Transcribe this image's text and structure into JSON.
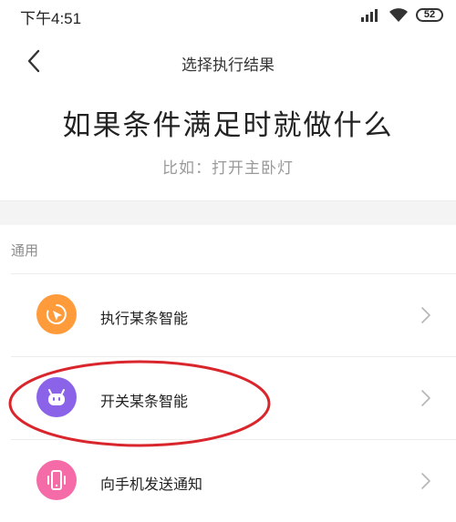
{
  "status_bar": {
    "time": "下午4:51",
    "battery": "52"
  },
  "nav": {
    "title": "选择执行结果"
  },
  "hero": {
    "title": "如果条件满足时就做什么",
    "subtitle": "比如：打开主卧灯"
  },
  "section": {
    "label": "通用"
  },
  "items": [
    {
      "label": "执行某条智能",
      "icon": "hand-pointer-icon",
      "color": "#FF9B3A"
    },
    {
      "label": "开关某条智能",
      "icon": "robot-icon",
      "color": "#8A63E8"
    },
    {
      "label": "向手机发送通知",
      "icon": "phone-vibrate-icon",
      "color": "#F46BA8"
    }
  ],
  "colors": {
    "highlight": "#D9262C",
    "background": "#FFFFFF",
    "band": "#F4F4F4"
  }
}
